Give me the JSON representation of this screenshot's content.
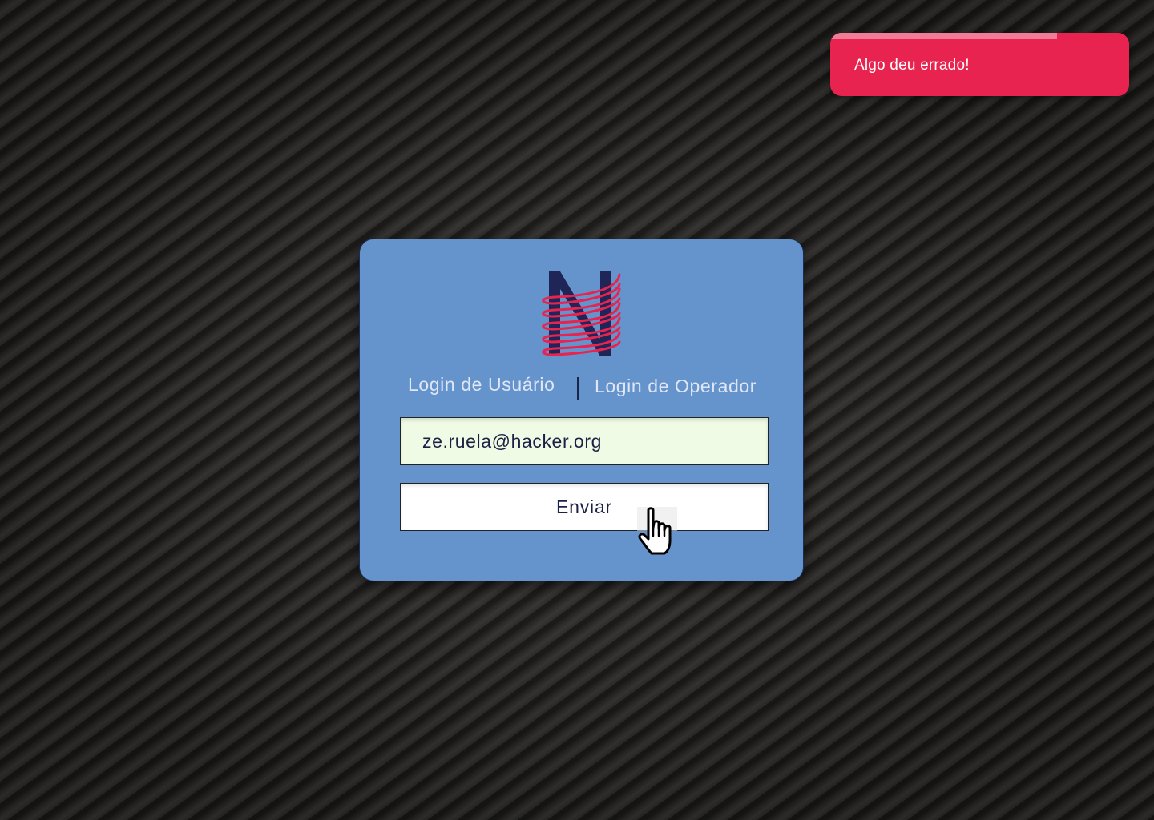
{
  "toast": {
    "message": "Algo deu errado!",
    "progress": 0.76,
    "color": "#e8234f",
    "progress_color": "#f17c95"
  },
  "login": {
    "logo_icon": "n-logo-icon",
    "tabs": [
      {
        "label": "Login de Usuário"
      },
      {
        "label": "Login de Operador"
      }
    ],
    "email_value": "ze.ruela@hacker.org",
    "submit_label": "Enviar"
  },
  "cursor": {
    "icon": "hand-pointer-icon"
  },
  "colors": {
    "card": "#6594cd",
    "accent": "#e8234f",
    "navy": "#1f2557",
    "input_bg": "#effbe5"
  }
}
